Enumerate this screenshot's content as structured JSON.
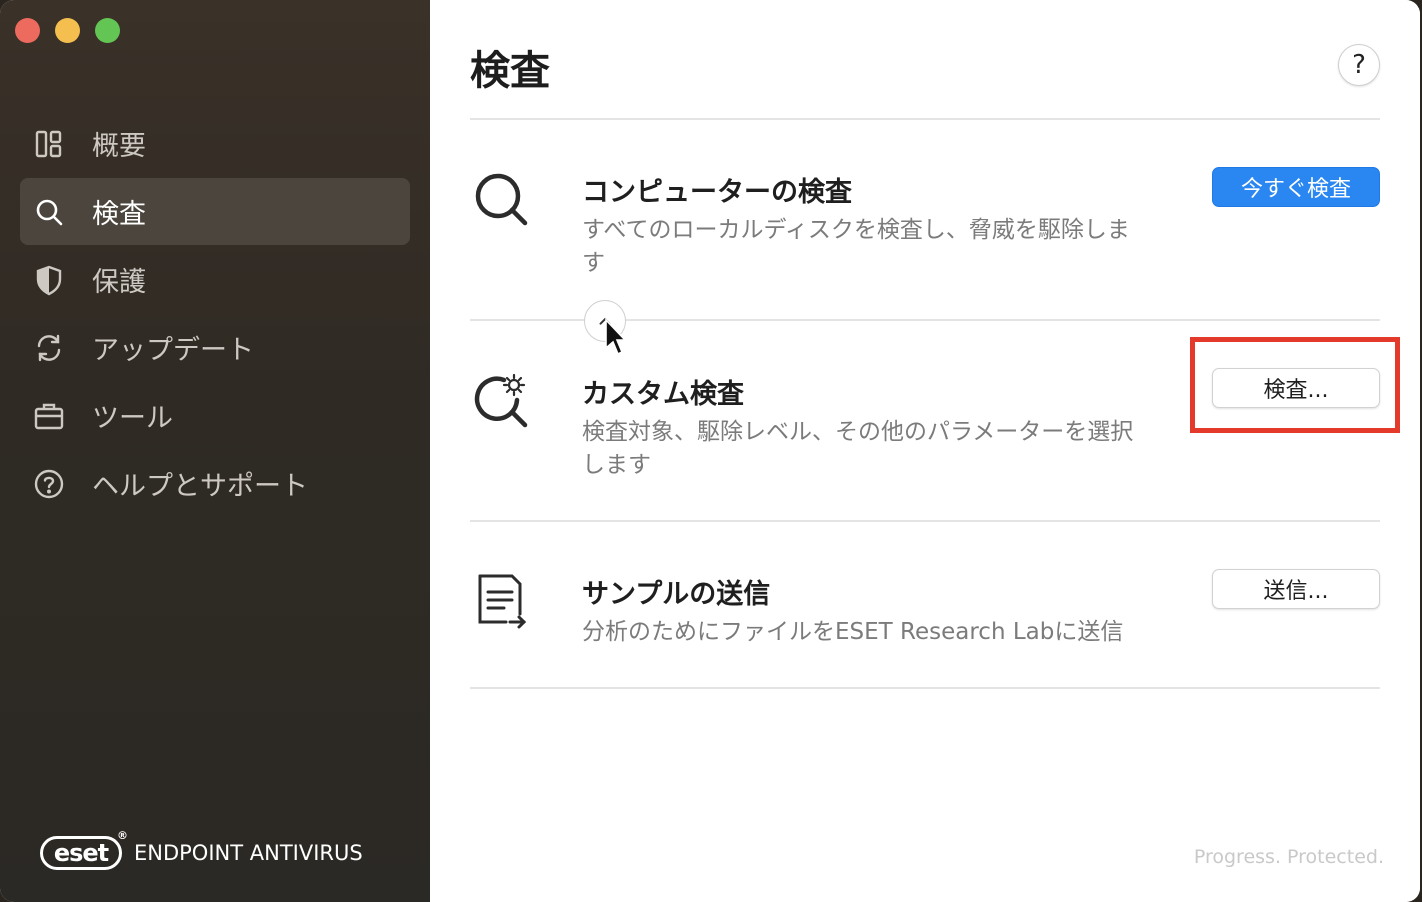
{
  "sidebar": {
    "items": [
      {
        "label": "概要",
        "icon": "overview-icon"
      },
      {
        "label": "検査",
        "icon": "search-icon",
        "active": true
      },
      {
        "label": "保護",
        "icon": "shield-icon"
      },
      {
        "label": "アップデート",
        "icon": "refresh-icon"
      },
      {
        "label": "ツール",
        "icon": "briefcase-icon"
      },
      {
        "label": "ヘルプとサポート",
        "icon": "question-icon"
      }
    ],
    "brand": {
      "logo": "eset",
      "product": "ENDPOINT ANTIVIRUS"
    }
  },
  "main": {
    "title": "検査",
    "help_label": "?",
    "rows": [
      {
        "title": "コンピューターの検査",
        "desc": "すべてのローカルディスクを検査し、脅威を駆除します",
        "button": "今すぐ検査",
        "icon": "magnifier-icon"
      },
      {
        "title": "カスタム検査",
        "desc": "検査対象、駆除レベル、その他のパラメーターを選択します",
        "button": "検査...",
        "icon": "custom-scan-icon"
      },
      {
        "title": "サンプルの送信",
        "desc": "分析のためにファイルをESET Research Labに送信",
        "button": "送信...",
        "icon": "document-send-icon"
      }
    ],
    "tagline": "Progress. Protected."
  },
  "colors": {
    "accent": "#2a86f1",
    "highlight": "#e43a2b",
    "sidebar_active": "#4c453d"
  }
}
